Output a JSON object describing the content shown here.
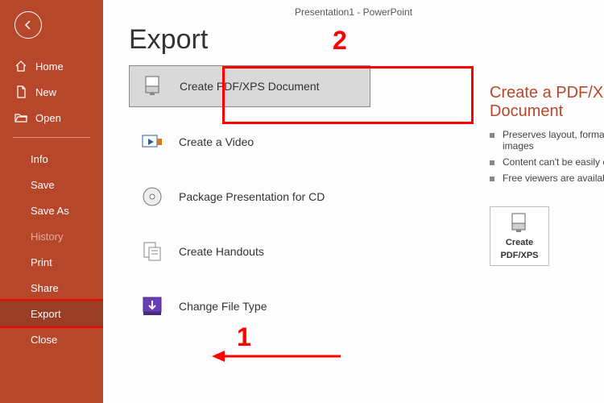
{
  "window_title": "Presentation1  -  PowerPoint",
  "page_title": "Export",
  "sidebar": {
    "home": "Home",
    "new": "New",
    "open": "Open",
    "info": "Info",
    "save": "Save",
    "save_as": "Save As",
    "history": "History",
    "print": "Print",
    "share": "Share",
    "export": "Export",
    "close": "Close"
  },
  "options": {
    "pdf": "Create PDF/XPS Document",
    "video": "Create a Video",
    "cd": "Package Presentation for CD",
    "handouts": "Create Handouts",
    "filetype": "Change File Type"
  },
  "right": {
    "title": "Create a PDF/XPS Document",
    "b1": "Preserves layout, formatting, fonts, and images",
    "b2": "Content can't be easily changed",
    "b3": "Free viewers are available on the web",
    "btn_line1": "Create",
    "btn_line2": "PDF/XPS"
  },
  "annotations": {
    "step1": "1",
    "step2": "2"
  }
}
